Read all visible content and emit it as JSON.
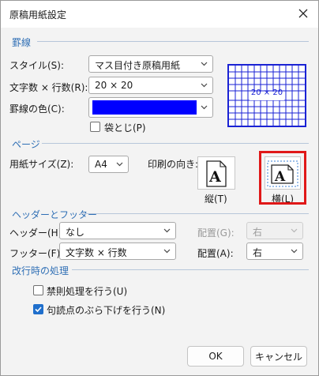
{
  "window": {
    "title": "原稿用紙設定"
  },
  "sections": {
    "grid_lines": "罫線",
    "page": "ページ",
    "header_footer": "ヘッダーとフッター",
    "line_break": "改行時の処理"
  },
  "grid": {
    "style_label": "スタイル(S):",
    "style_value": "マス目付き原稿用紙",
    "count_label": "文字数 × 行数(R):",
    "count_value": "20 × 20",
    "color_label": "罫線の色(C):",
    "color_value": "#0000ff",
    "fold_label": "袋とじ(P)",
    "fold_checked": false,
    "preview_label": "20 × 20"
  },
  "page": {
    "size_label": "用紙サイズ(Z):",
    "size_value": "A4",
    "orientation_label": "印刷の向き:",
    "portrait_label": "縦(T)",
    "landscape_label": "横(L)",
    "selected_orientation": "landscape"
  },
  "header_footer": {
    "header_label": "ヘッダー(H):",
    "header_value": "なし",
    "header_align_label": "配置(G):",
    "header_align_value": "右",
    "footer_label": "フッター(F):",
    "footer_value": "文字数 × 行数",
    "footer_align_label": "配置(A):",
    "footer_align_value": "右"
  },
  "line_break": {
    "kinsoku_label": "禁則処理を行う(U)",
    "kinsoku_checked": false,
    "hanging_label": "句読点のぶら下げを行う(N)",
    "hanging_checked": true
  },
  "buttons": {
    "ok": "OK",
    "cancel": "キャンセル"
  },
  "colors": {
    "accent": "#2f6fb5",
    "highlight": "#e01818",
    "grid_line": "#1a22d4"
  },
  "icons": {
    "close": "close-icon",
    "dropdown": "chevron-down-icon",
    "portrait": "portrait-page-icon",
    "landscape": "landscape-page-icon",
    "check": "check-icon"
  }
}
